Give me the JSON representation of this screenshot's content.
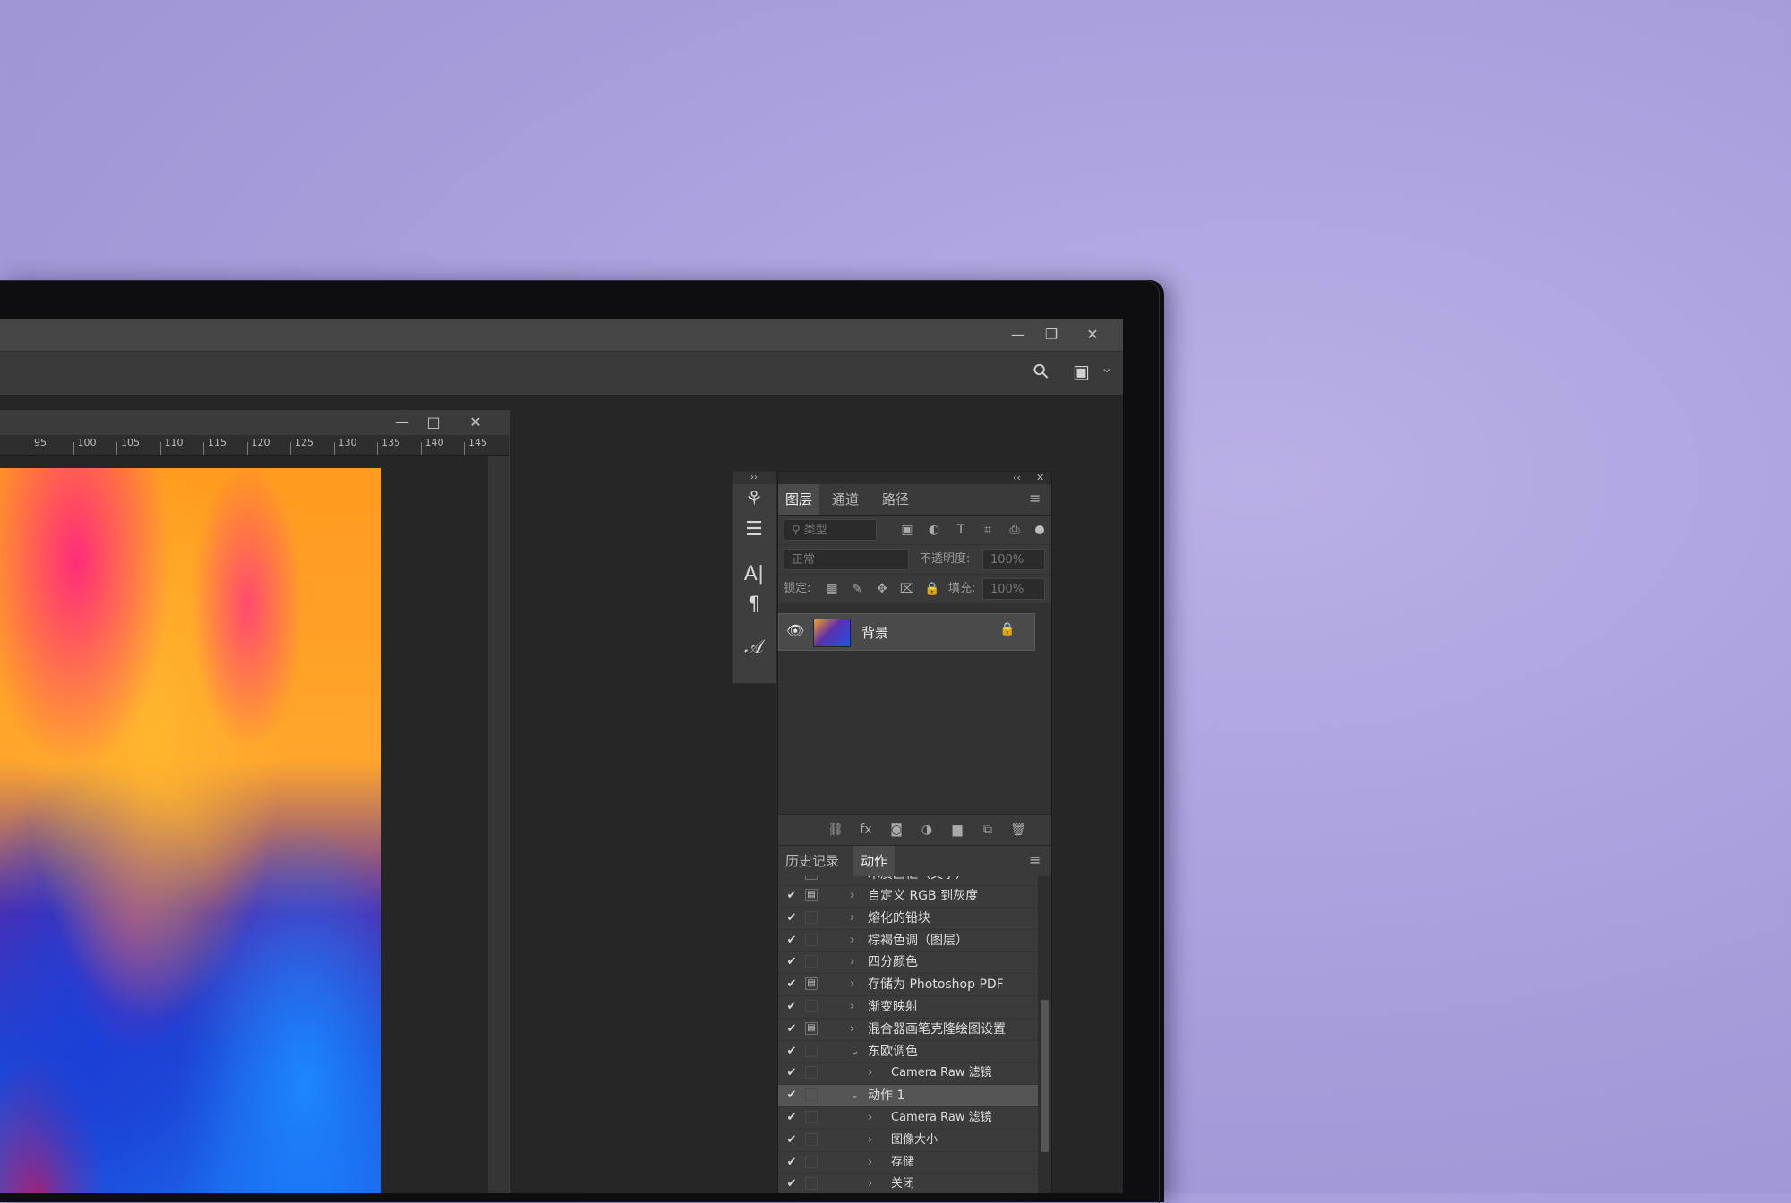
{
  "window": {
    "minimize": "—",
    "restore": "❐",
    "close": "✕"
  },
  "toolbar": {
    "search_icon": "⚲",
    "workspace_icon": "▣",
    "dropdown_icon": "⌄"
  },
  "document": {
    "minimize": "—",
    "maximize": "□",
    "close": "✕",
    "ruler_ticks": [
      "95",
      "100",
      "105",
      "110",
      "115",
      "120",
      "125",
      "130",
      "135",
      "140",
      "145"
    ]
  },
  "minitoolbar": {
    "grip": "››",
    "icons": [
      "brush-presets-icon",
      "adjustments-icon",
      "character-icon",
      "paragraph-icon",
      "glyphs-icon"
    ],
    "glyphs": [
      "⚘",
      "☰",
      "A|",
      "¶",
      "𝒜"
    ]
  },
  "layers_panel": {
    "collapse": "‹‹",
    "close": "✕",
    "tabs": [
      "图层",
      "通道",
      "路径"
    ],
    "active_tab": "图层",
    "menu_icon": "≡",
    "filter_placeholder": "类型",
    "filter_icons": [
      "▣",
      "◐",
      "T",
      "⌗",
      "⎙"
    ],
    "blend_mode": "正常",
    "opacity_label": "不透明度:",
    "opacity_value": "100%",
    "lock_label": "锁定:",
    "lock_icons": [
      "▦",
      "✎",
      "✥",
      "⌧",
      "🔒"
    ],
    "fill_label": "填充:",
    "fill_value": "100%",
    "layers": [
      {
        "name": "背景",
        "visible": true,
        "locked": true
      }
    ],
    "footer_icons": [
      "⛓",
      "fx",
      "◙",
      "◑",
      "▆",
      "⧉",
      "🗑"
    ]
  },
  "actions_panel": {
    "tabs": [
      "历史记录",
      "动作"
    ],
    "active_tab": "动作",
    "menu_icon": "≡",
    "partial_top": "木质画框（文字）",
    "items": [
      {
        "name": "自定义 RGB 到灰度",
        "checked": true,
        "dialog": true,
        "level": 0,
        "expanded": false
      },
      {
        "name": "熔化的铅块",
        "checked": true,
        "dialog": false,
        "level": 0,
        "expanded": false
      },
      {
        "name": "棕褐色调（图层）",
        "checked": true,
        "dialog": false,
        "level": 0,
        "expanded": false
      },
      {
        "name": "四分颜色",
        "checked": true,
        "dialog": false,
        "level": 0,
        "expanded": false
      },
      {
        "name": "存储为 Photoshop PDF",
        "checked": true,
        "dialog": true,
        "level": 0,
        "expanded": false
      },
      {
        "name": "渐变映射",
        "checked": true,
        "dialog": false,
        "level": 0,
        "expanded": false
      },
      {
        "name": "混合器画笔克隆绘图设置",
        "checked": true,
        "dialog": true,
        "level": 0,
        "expanded": false
      },
      {
        "name": "东欧调色",
        "checked": true,
        "dialog": false,
        "level": 0,
        "expanded": true
      },
      {
        "name": "Camera Raw 滤镜",
        "checked": true,
        "dialog": false,
        "level": 1,
        "expanded": false
      },
      {
        "name": "动作 1",
        "checked": true,
        "dialog": false,
        "level": 0,
        "expanded": true,
        "selected": true
      },
      {
        "name": "Camera Raw 滤镜",
        "checked": true,
        "dialog": false,
        "level": 1,
        "expanded": false
      },
      {
        "name": "图像大小",
        "checked": true,
        "dialog": false,
        "level": 1,
        "expanded": false
      },
      {
        "name": "存储",
        "checked": true,
        "dialog": false,
        "level": 1,
        "expanded": false
      },
      {
        "name": "关闭",
        "checked": true,
        "dialog": false,
        "level": 1,
        "expanded": false
      }
    ]
  },
  "colors": {
    "background": "#a79ddb",
    "app_dark": "#252525",
    "panel": "#323232",
    "selected_row": "#555555"
  }
}
